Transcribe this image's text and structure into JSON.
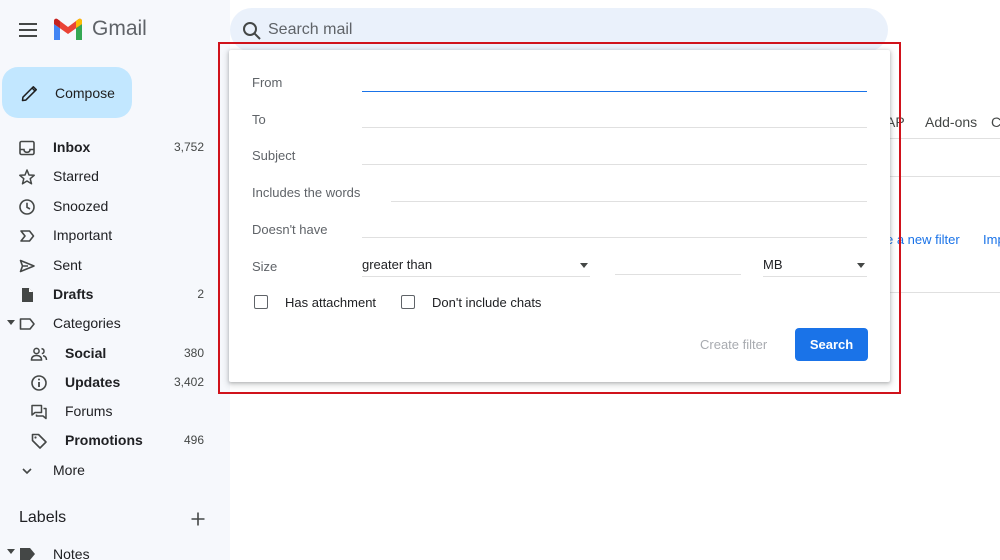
{
  "app": {
    "name": "Gmail"
  },
  "search": {
    "placeholder": "Search mail"
  },
  "compose": {
    "label": "Compose"
  },
  "nav": {
    "inbox": {
      "label": "Inbox",
      "count": "3,752"
    },
    "starred": {
      "label": "Starred"
    },
    "snoozed": {
      "label": "Snoozed"
    },
    "important": {
      "label": "Important"
    },
    "sent": {
      "label": "Sent"
    },
    "drafts": {
      "label": "Drafts",
      "count": "2"
    },
    "categories": {
      "label": "Categories"
    },
    "social": {
      "label": "Social",
      "count": "380"
    },
    "updates": {
      "label": "Updates",
      "count": "3,402"
    },
    "forums": {
      "label": "Forums"
    },
    "promotions": {
      "label": "Promotions",
      "count": "496"
    },
    "more": {
      "label": "More"
    }
  },
  "labels": {
    "heading": "Labels",
    "items": [
      "Notes"
    ]
  },
  "background": {
    "tab_imap": "AP",
    "tab_addons": "Add-ons",
    "tab_c": "C",
    "link_create": "e a new filter",
    "link_imp": "Imp"
  },
  "dialog": {
    "from_label": "From",
    "to_label": "To",
    "subject_label": "Subject",
    "includes_label": "Includes the words",
    "doesnt_have_label": "Doesn't have",
    "size_label": "Size",
    "size_operator": "greater than",
    "size_unit": "MB",
    "has_attachment_label": "Has attachment",
    "no_chats_label": "Don't include chats",
    "create_filter_label": "Create filter",
    "search_button_label": "Search"
  },
  "colors": {
    "sidebar_bg": "#f6f8fc",
    "compose_bg": "#c2e7ff",
    "search_bar_bg": "#eaf1fb",
    "primary_blue": "#1a73e8",
    "highlight_red": "#d0121b"
  }
}
